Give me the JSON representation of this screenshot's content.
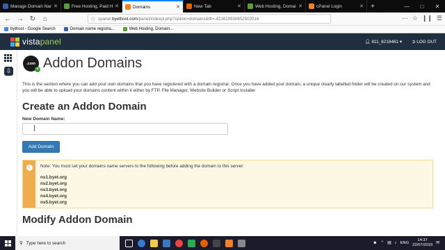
{
  "browser": {
    "tabs": [
      {
        "title": "Manage Domain Nam",
        "active": false,
        "color": "#3b5ca8"
      },
      {
        "title": "Free Hosting, Paid Ho",
        "active": false,
        "color": "#5a9e3a"
      },
      {
        "title": "Domains",
        "active": true,
        "color": "#f08024"
      },
      {
        "title": "New Tab",
        "active": false,
        "color": "#e66000"
      },
      {
        "title": "Web Hosting, Domai",
        "active": false,
        "color": "#5a9e3a"
      },
      {
        "title": "cPanel Login",
        "active": false,
        "color": "#f08024"
      }
    ],
    "url_prefix": "cpanel.",
    "url_domain": "byethost.com",
    "url_rest": "/panel/indexpl.php?option=domains&ttt=-423819930652502016",
    "bookmarks": [
      {
        "label": "bythost - Google Search",
        "color": "#4285f4"
      },
      {
        "label": "Domain name registra...",
        "color": "#3b5ca8"
      },
      {
        "label": "Web Hosting, Domain...",
        "color": "#5a9e3a"
      }
    ]
  },
  "panel": {
    "logo_prefix": "vista",
    "logo_suffix": "panel",
    "user_label": "811_6218461",
    "logout_label": "LOG OUT"
  },
  "page": {
    "icon_text": ".com",
    "title": "Addon Domains",
    "intro": "This is the section where you can add your own domains that you have registered with a domain registrar. Once you have added your domain, a unique clearly labelled folder will be created on our system and you will be able to upload your domains content within it either by FTP, File Manager, Website Builder or Script Installer",
    "create_heading": "Create an Addon Domain",
    "field_label": "New Domain Name:",
    "field_value": "",
    "add_button": "Add Domain",
    "alert_note": "Note: You must set your domains name servers to the following before adding the domain to this server:",
    "nameservers": [
      "ns1.byet.org",
      "ns2.byet.org",
      "ns3.byet.org",
      "ns4.byet.org",
      "ns5.byet.org"
    ],
    "modify_heading": "Modify Addon Domain"
  },
  "taskbar": {
    "search_placeholder": "Type here to search",
    "language": "ENG",
    "time": "14:37",
    "date": "22/07/2019"
  }
}
